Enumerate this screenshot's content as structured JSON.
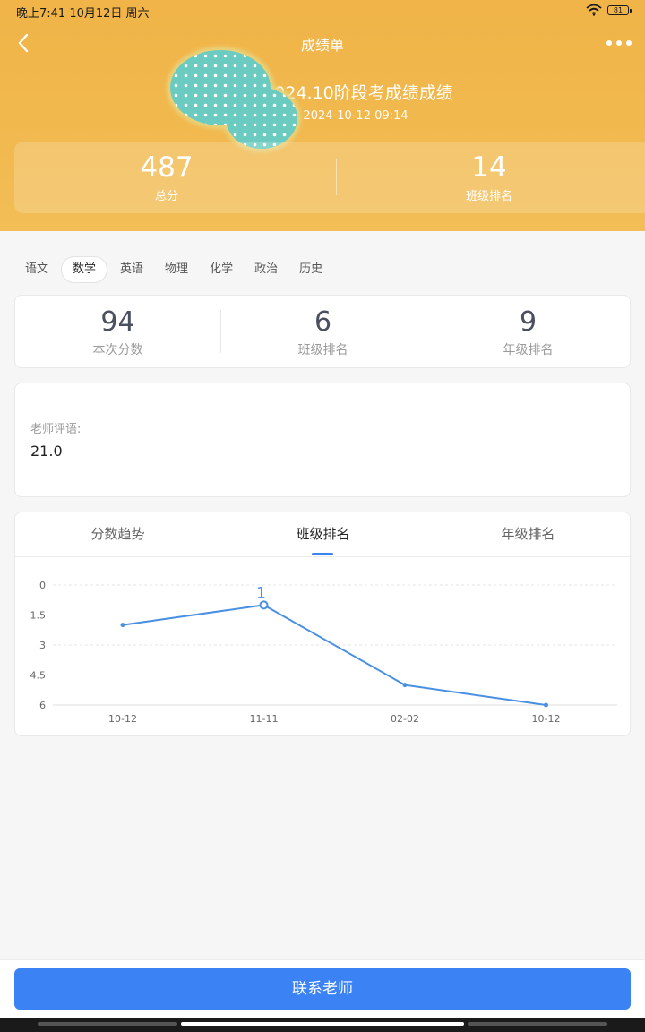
{
  "status_bar": {
    "time": "晚上7:41 10月12日 周六",
    "battery": "81"
  },
  "nav": {
    "title": "成绩单",
    "back_icon": "chevron-left-icon",
    "more_icon": "more-dots-icon"
  },
  "exam": {
    "title": "2024.10阶段考成绩成绩",
    "date": "2024-10-12 09:14"
  },
  "summary": {
    "total_value": "487",
    "total_label": "总分",
    "rank_value": "14",
    "rank_label": "班级排名"
  },
  "subjects": {
    "items": [
      "语文",
      "数学",
      "英语",
      "物理",
      "化学",
      "政治",
      "历史"
    ],
    "active": "数学"
  },
  "score": {
    "items": [
      {
        "value": "94",
        "label": "本次分数"
      },
      {
        "value": "6",
        "label": "班级排名"
      },
      {
        "value": "9",
        "label": "年级排名"
      }
    ]
  },
  "comment": {
    "label": "老师评语:",
    "value": "21.0"
  },
  "chart_tabs": {
    "items": [
      "分数趋势",
      "班级排名",
      "年级排名"
    ],
    "active": "班级排名"
  },
  "chart_data": {
    "type": "line",
    "x": [
      "10-12",
      "11-11",
      "02-02",
      "10-12"
    ],
    "series": [
      {
        "values": [
          2,
          1,
          5,
          6
        ]
      }
    ],
    "ylim": [
      0,
      6
    ],
    "y_ticks": [
      "0",
      "1.5",
      "3",
      "4.5",
      "6"
    ],
    "y_inverted": true,
    "highlight": {
      "index": 1,
      "label": "1"
    },
    "grid": true,
    "color": "#4a90e2"
  },
  "footer": {
    "contact_label": "联系老师"
  },
  "colors": {
    "header": "#f1b94f",
    "primary": "#3b82f4",
    "line": "#4a90e2"
  }
}
